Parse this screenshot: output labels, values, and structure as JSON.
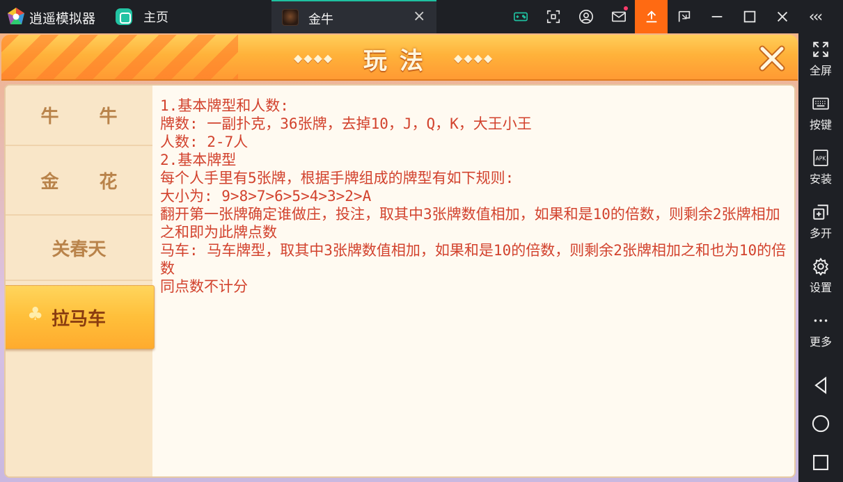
{
  "titlebar": {
    "app_name": "逍遥模拟器",
    "home_label": "主页",
    "tab_label": "金牛",
    "tab_close": "×",
    "icons": [
      "gamepad-icon",
      "screenshot-icon",
      "account-icon",
      "mail-icon",
      "upload-icon",
      "screen-mode-icon",
      "minimize-icon",
      "maximize-icon",
      "close-icon"
    ]
  },
  "sidebar": {
    "items": [
      {
        "label": "全屏",
        "icon": "fullscreen-icon"
      },
      {
        "label": "按键",
        "icon": "keyboard-icon"
      },
      {
        "label": "安装",
        "icon": "apk-icon"
      },
      {
        "label": "多开",
        "icon": "multi-instance-icon"
      },
      {
        "label": "设置",
        "icon": "gear-icon"
      },
      {
        "label": "更多",
        "icon": "more-icon"
      }
    ],
    "collapse": "‹‹‹",
    "nav": [
      "back-icon",
      "home-circle-icon",
      "recents-icon"
    ]
  },
  "game": {
    "title": "玩法",
    "deco_left": "◆◆◆◆",
    "deco_right": "◆◆◆◆",
    "menu": [
      {
        "label": "牛牛",
        "active": false
      },
      {
        "label": "金花",
        "active": false
      },
      {
        "label": "关春天",
        "active": false
      },
      {
        "label": "拉马车",
        "active": true
      }
    ],
    "clover": "♣",
    "rules": [
      "1.基本牌型和人数:",
      "牌数: 一副扑克，36张牌，去掉10，J，Q，K，大王小王",
      "人数: 2-7人",
      "2.基本牌型",
      "每个人手里有5张牌，根据手牌组成的牌型有如下规则:",
      "大小为: 9>8>7>6>5>4>3>2>A",
      "翻开第一张牌确定谁做庄，投注，取其中3张牌数值相加，如果和是10的倍数，则剩余2张牌相加之和即为此牌点数",
      "马车: 马车牌型，取其中3张牌数值相加，如果和是10的倍数，则剩余2张牌相加之和也为10的倍数",
      "同点数不计分"
    ]
  },
  "colors": {
    "accent_green": "#1fc0a0",
    "upload_orange": "#ff6a12",
    "rule_text": "#d2422d",
    "banner_orange": "#ffb23a"
  }
}
